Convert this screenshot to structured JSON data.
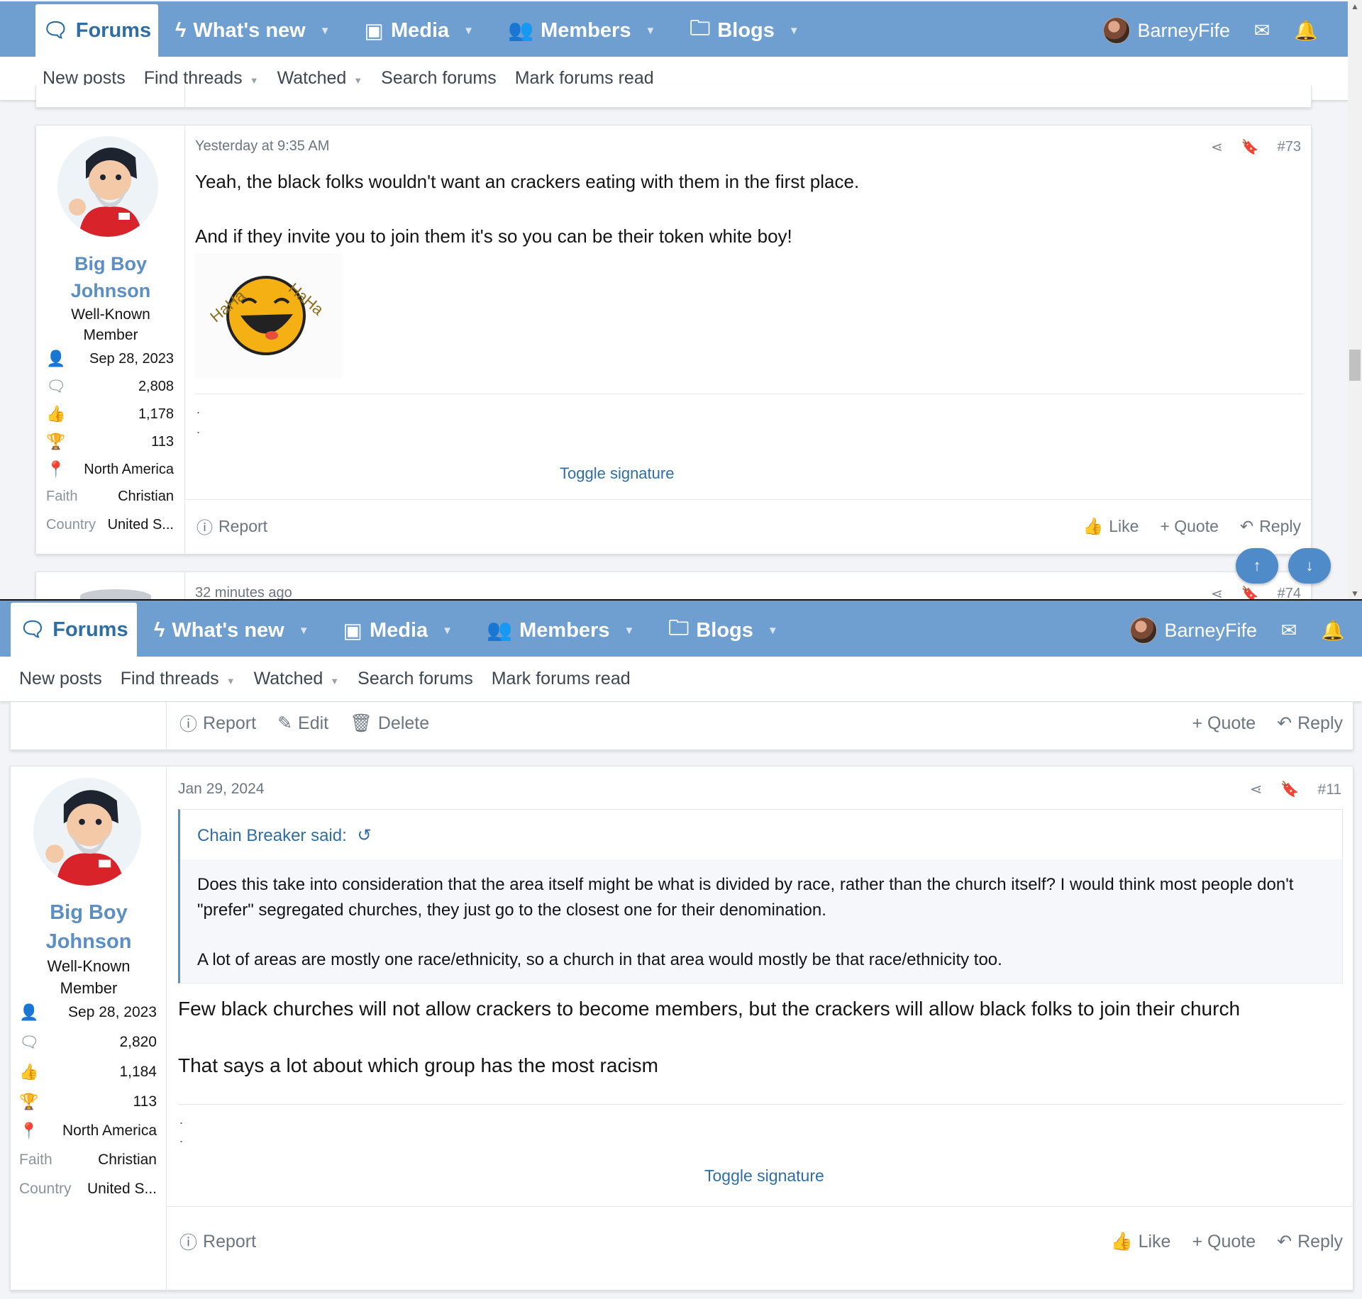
{
  "nav": {
    "tabs": [
      {
        "label": "Forums",
        "icon": "forums-icon"
      },
      {
        "label": "What's new",
        "icon": "lightning-icon"
      },
      {
        "label": "Media",
        "icon": "media-icon"
      },
      {
        "label": "Members",
        "icon": "members-icon"
      },
      {
        "label": "Blogs",
        "icon": "folder-icon"
      }
    ],
    "username": "BarneyFife",
    "accent_color": "#6e9fd0",
    "link_color": "#2f6ea5"
  },
  "subnav": {
    "items": [
      "New posts",
      "Find threads",
      "Watched",
      "Search forums",
      "Mark forums read"
    ]
  },
  "post73": {
    "author": {
      "name_line1": "Big Boy",
      "name_line2": "Johnson",
      "title_line1": "Well-Known",
      "title_line2": "Member"
    },
    "stats": {
      "joined": "Sep 28, 2023",
      "messages": "2,808",
      "reactions": "1,178",
      "points": "113",
      "location": "North America",
      "faith_label": "Faith",
      "faith": "Christian",
      "country_label": "Country",
      "country": "United S..."
    },
    "time": "Yesterday at 9:35 AM",
    "number": "#73",
    "body_line1": "Yeah, the black folks wouldn't want an crackers eating with them in the first place.",
    "body_line2": "And if they invite you to join them it's so you can be their token white boy!",
    "image_text": {
      "ha_left": "HaHa",
      "ha_right": "HaHa"
    },
    "sig_dot1": ".",
    "sig_dot2": ".",
    "toggle_signature": "Toggle signature",
    "actions": {
      "report": "Report",
      "like": "Like",
      "quote": "+ Quote",
      "reply": "Reply"
    }
  },
  "post74_peek": {
    "time": "32 minutes ago",
    "number": "#74"
  },
  "prev_post_footer": {
    "report": "Report",
    "edit": "Edit",
    "delete": "Delete",
    "quote": "+ Quote",
    "reply": "Reply"
  },
  "post11": {
    "author": {
      "name_line1": "Big Boy",
      "name_line2": "Johnson",
      "title_line1": "Well-Known",
      "title_line2": "Member"
    },
    "stats": {
      "joined": "Sep 28, 2023",
      "messages": "2,820",
      "reactions": "1,184",
      "points": "113",
      "location": "North America",
      "faith_label": "Faith",
      "faith": "Christian",
      "country_label": "Country",
      "country": "United S..."
    },
    "time": "Jan 29, 2024",
    "number": "#11",
    "quote": {
      "author": "Chain Breaker said:",
      "para1": "Does this take into consideration that the area itself might be what is divided by race, rather than the church itself? I would think most people don't \"prefer\" segregated churches, they just go to the closest one for their denomination.",
      "para2": "A lot of areas are mostly one race/ethnicity, so a church in that area would mostly be that race/ethnicity too."
    },
    "body_line1": "Few black churches will not allow crackers to become members, but the crackers will allow black folks to join their church",
    "body_line2": "That says a lot about which group has the most racism",
    "sig_dot1": ".",
    "sig_dot2": ".",
    "toggle_signature": "Toggle signature",
    "actions": {
      "report": "Report",
      "like": "Like",
      "quote": "+ Quote",
      "reply": "Reply"
    }
  }
}
